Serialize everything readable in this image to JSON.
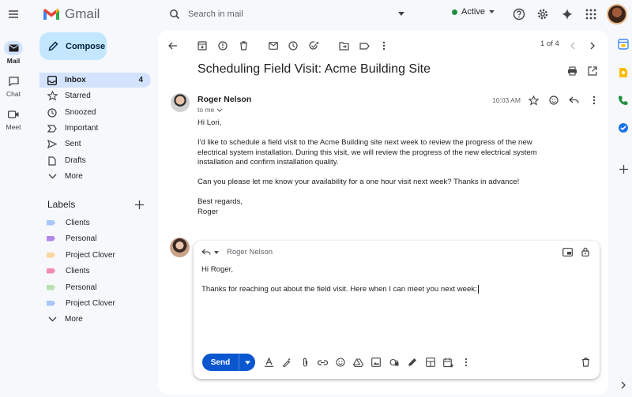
{
  "app": {
    "name": "Gmail"
  },
  "search": {
    "placeholder": "Search in mail"
  },
  "status": {
    "label": "Active",
    "color": "#1e8e3e"
  },
  "rail": [
    {
      "label": "Mail",
      "icon": "mail-icon"
    },
    {
      "label": "Chat",
      "icon": "chat-icon"
    },
    {
      "label": "Meet",
      "icon": "meet-icon"
    }
  ],
  "sidebar": {
    "compose_label": "Compose",
    "items": [
      {
        "label": "Inbox",
        "count": "4",
        "icon": "inbox-icon"
      },
      {
        "label": "Starred",
        "icon": "star-icon"
      },
      {
        "label": "Snoozed",
        "icon": "clock-icon"
      },
      {
        "label": "Important",
        "icon": "important-icon"
      },
      {
        "label": "Sent",
        "icon": "send-icon"
      },
      {
        "label": "Drafts",
        "icon": "draft-icon"
      },
      {
        "label": "More",
        "icon": "chevron-down-icon"
      }
    ],
    "labels_heading": "Labels",
    "labels": [
      {
        "label": "Clients",
        "color": "#a8c7fa"
      },
      {
        "label": "Personal",
        "color": "#b388eb"
      },
      {
        "label": "Project Clover",
        "color": "#fad7a0"
      },
      {
        "label": "Clients",
        "color": "#f28bb0"
      },
      {
        "label": "Personal",
        "color": "#b7e1b0"
      },
      {
        "label": "Project Clover",
        "color": "#a8c7fa"
      }
    ],
    "labels_more": "More"
  },
  "thread": {
    "pager": "1 of 4",
    "subject": "Scheduling Field Visit: Acme Building Site",
    "message": {
      "sender": "Roger Nelson",
      "recipient": "to me",
      "time": "10:03 AM",
      "greeting": "Hi Lori,",
      "paragraph1": "I'd like to schedule a field visit to the Acme Building site next week to review the progress of the new electrical system installation. During this visit, we will review the progress of the new electrical system installation and confirm installation quality.",
      "paragraph2": "Can you please let me know your availability for a one hour visit next week? Thanks in advance!",
      "closing": "Best regards,",
      "signature": "Roger"
    }
  },
  "reply": {
    "to": "Roger Nelson",
    "greeting": "Hi Roger,",
    "text": "Thanks for reaching out about the field visit. Here when I can meet you next week:",
    "send_label": "Send"
  },
  "colors": {
    "accent": "#0b57d0",
    "compose": "#c2e7ff",
    "selected": "#d3e3fd"
  }
}
